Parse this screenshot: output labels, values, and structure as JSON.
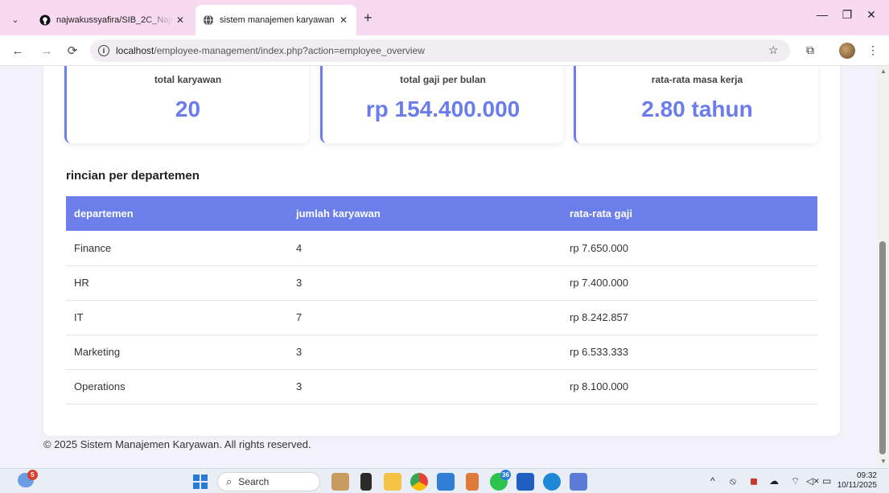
{
  "browser": {
    "tabs": [
      {
        "title": "najwakussyafira/SIB_2C_Najwak",
        "icon": "github-icon",
        "active": false
      },
      {
        "title": "sistem manajemen karyawan",
        "icon": "globe-icon",
        "active": true
      }
    ],
    "url_host": "localhost",
    "url_path": "/employee-management/index.php?action=employee_overview"
  },
  "stats": [
    {
      "title": "total karyawan",
      "value": "20"
    },
    {
      "title": "total gaji per bulan",
      "value": "rp 154.400.000"
    },
    {
      "title": "rata-rata masa kerja",
      "value": "2.80 tahun"
    }
  ],
  "section_title": "rincian per departemen",
  "table": {
    "headers": [
      "departemen",
      "jumlah karyawan",
      "rata-rata gaji"
    ],
    "rows": [
      [
        "Finance",
        "4",
        "rp 7.650.000"
      ],
      [
        "HR",
        "3",
        "rp 7.400.000"
      ],
      [
        "IT",
        "7",
        "rp 8.242.857"
      ],
      [
        "Marketing",
        "3",
        "rp 6.533.333"
      ],
      [
        "Operations",
        "3",
        "rp 8.100.000"
      ]
    ]
  },
  "footer": "© 2025 Sistem Manajemen Karyawan. All rights reserved.",
  "taskbar": {
    "weather_badge": "5",
    "search_placeholder": "Search",
    "whatsapp_badge": "36",
    "time": "09:32",
    "date": "10/11/2025"
  },
  "colors": {
    "accent": "#6b7cec",
    "table_header": "#6b7ee9",
    "tab_strip": "#f7d9f0"
  }
}
